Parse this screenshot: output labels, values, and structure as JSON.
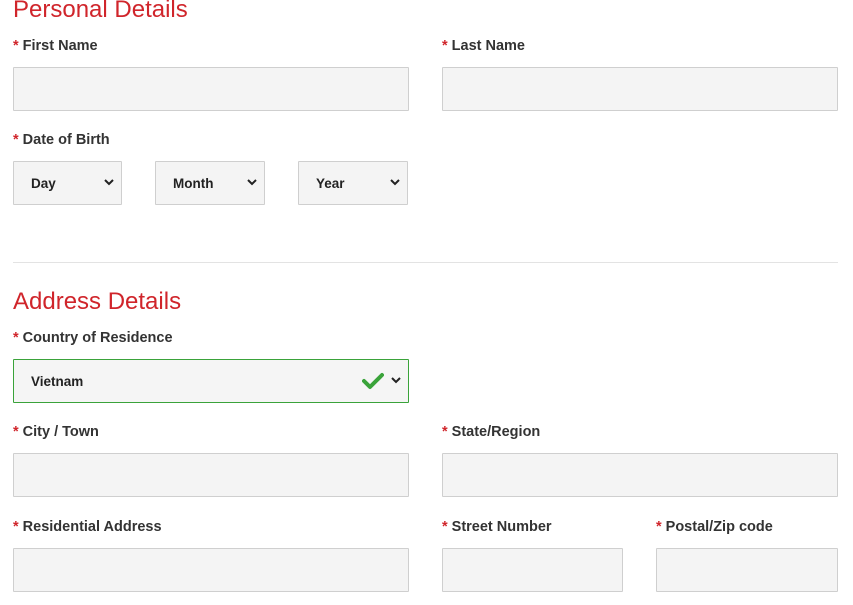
{
  "personal": {
    "title": "Personal Details",
    "first_name": {
      "label": "First Name",
      "value": ""
    },
    "last_name": {
      "label": "Last Name",
      "value": ""
    },
    "dob": {
      "label": "Date of Birth",
      "day": "Day",
      "month": "Month",
      "year": "Year"
    }
  },
  "address": {
    "title": "Address Details",
    "country": {
      "label": "Country of Residence",
      "value": "Vietnam"
    },
    "city": {
      "label": "City / Town",
      "value": ""
    },
    "state": {
      "label": "State/Region",
      "value": ""
    },
    "residential": {
      "label": "Residential Address",
      "value": ""
    },
    "street_number": {
      "label": "Street Number",
      "value": ""
    },
    "postal": {
      "label": "Postal/Zip code",
      "value": ""
    }
  },
  "required_marker": "*",
  "colors": {
    "accent": "#d0252b",
    "valid": "#3aa33a",
    "field_bg": "#f4f4f4",
    "field_border": "#cfcfcf"
  },
  "icons": {
    "select_arrow": "chevron-down-icon",
    "valid": "checkmark-icon"
  }
}
